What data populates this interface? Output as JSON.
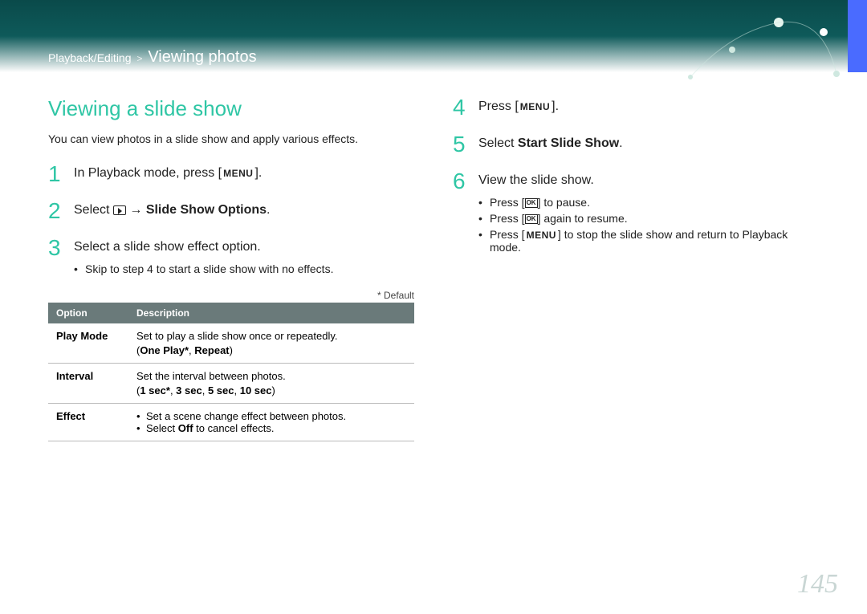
{
  "breadcrumb": {
    "section": "Playback/Editing",
    "title": "Viewing photos"
  },
  "heading": "Viewing a slide show",
  "intro": "You can view photos in a slide show and apply various effects.",
  "keys": {
    "menu": "MENU",
    "ok": "OK"
  },
  "steps": {
    "s1": {
      "num": "1",
      "text_a": "In Playback mode, press [",
      "text_b": "]."
    },
    "s2": {
      "num": "2",
      "text_a": "Select ",
      "arrow": " → ",
      "bold": "Slide Show Options",
      "text_b": "."
    },
    "s3": {
      "num": "3",
      "text": "Select a slide show effect option.",
      "sub": "Skip to step 4 to start a slide show with no effects."
    },
    "s4": {
      "num": "4",
      "text_a": "Press [",
      "text_b": "]."
    },
    "s5": {
      "num": "5",
      "text_a": "Select ",
      "bold": "Start Slide Show",
      "text_b": "."
    },
    "s6": {
      "num": "6",
      "text": "View the slide show.",
      "sub1_a": "Press [",
      "sub1_b": "] to pause.",
      "sub2_a": "Press [",
      "sub2_b": "] again to resume.",
      "sub3_a": "Press [",
      "sub3_b": "] to stop the slide show and return to Playback mode."
    }
  },
  "default_note": "* Default",
  "table": {
    "headers": {
      "opt": "Option",
      "desc": "Description"
    },
    "rows": {
      "r1": {
        "opt": "Play Mode",
        "desc": "Set to play a slide show once or repeatedly.",
        "vals_a": "(",
        "vals_b": "One Play*",
        "vals_c": ", ",
        "vals_d": "Repeat",
        "vals_e": ")"
      },
      "r2": {
        "opt": "Interval",
        "desc": "Set the interval between photos.",
        "vals_a": "(",
        "v1": "1 sec*",
        "c": ", ",
        "v2": "3 sec",
        "v3": "5 sec",
        "v4": "10 sec",
        "vals_e": ")"
      },
      "r3": {
        "opt": "Effect",
        "b1": "Set a scene change effect between photos.",
        "b2_a": "Select ",
        "b2_bold": "Off",
        "b2_b": " to cancel effects."
      }
    }
  },
  "page_number": "145"
}
